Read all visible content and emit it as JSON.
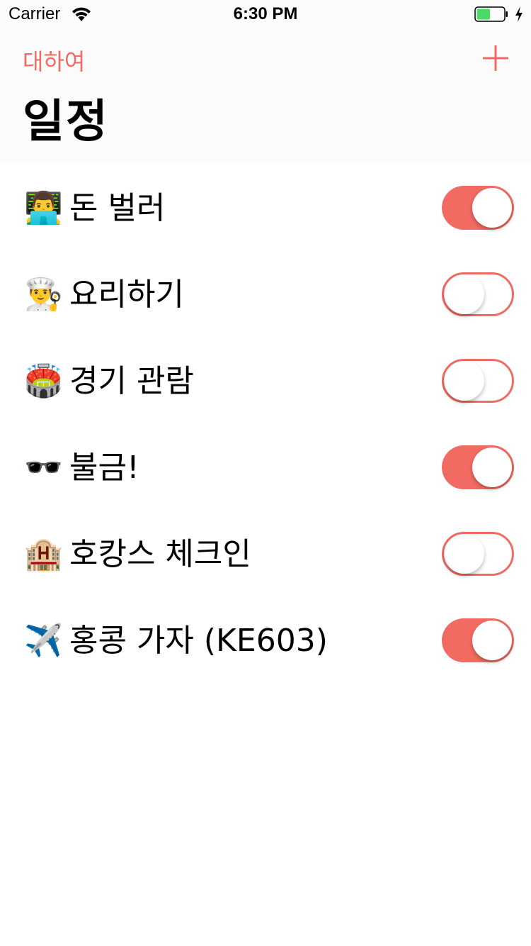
{
  "status_bar": {
    "carrier": "Carrier",
    "time": "6:30 PM",
    "battery_level": 0.5,
    "battery_color": "#4cd964",
    "charging": true
  },
  "nav": {
    "back_label": "대하여",
    "add_icon": "plus-icon",
    "title": "일정"
  },
  "accent_color": "#f26b62",
  "schedule": [
    {
      "emoji": "👨‍💻",
      "label": "돈 벌러",
      "enabled": true
    },
    {
      "emoji": "👨‍🍳",
      "label": "요리하기",
      "enabled": false
    },
    {
      "emoji": "🏟️",
      "label": "경기 관람",
      "enabled": false
    },
    {
      "emoji": "🕶️",
      "label": "불금!",
      "enabled": true
    },
    {
      "emoji": "🏨",
      "label": "호캉스 체크인",
      "enabled": false
    },
    {
      "emoji": "✈️",
      "label": "홍콩 가자 (KE603)",
      "enabled": true
    }
  ]
}
